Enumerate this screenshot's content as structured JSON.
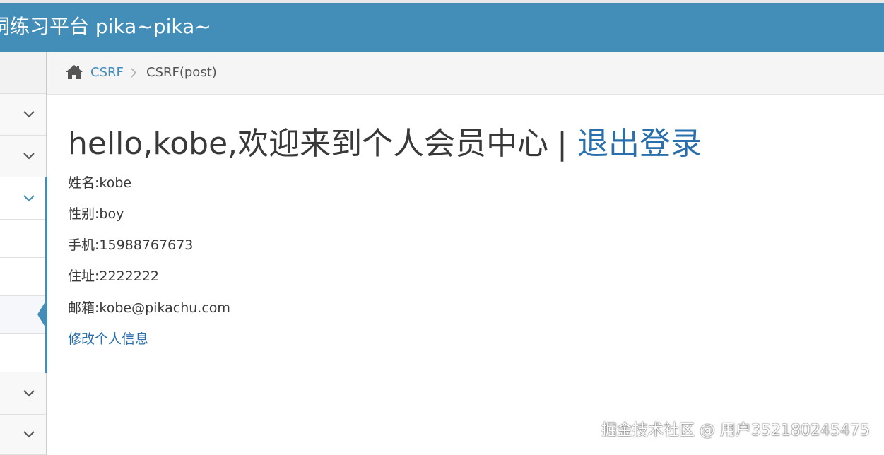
{
  "header": {
    "brand": "漏洞练习平台 pika~pika~",
    "brand_visible": "洞练习平台 pika~pika~"
  },
  "sidebar": {
    "rows": [
      {
        "has_chevron": true,
        "expanded": false
      },
      {
        "has_chevron": true,
        "expanded": false
      },
      {
        "has_chevron": true,
        "expanded": true
      },
      {
        "has_chevron": false
      },
      {
        "has_chevron": false
      },
      {
        "has_chevron": false,
        "active": true
      },
      {
        "has_chevron": false
      },
      {
        "has_chevron": true,
        "expanded": false
      },
      {
        "has_chevron": true,
        "expanded": false
      }
    ]
  },
  "breadcrumb": {
    "home_icon": "home-icon",
    "parent": "CSRF",
    "current": "CSRF(post)"
  },
  "main": {
    "heading_greeting": "hello,kobe,欢迎来到个人会员中心",
    "heading_separator": "|",
    "logout_label": "退出登录",
    "info": [
      "姓名:kobe",
      "性别:boy",
      "手机:15988767673",
      "住址:2222222",
      "邮箱:kobe@pikachu.com"
    ],
    "edit_link": "修改个人信息"
  },
  "watermark": "掘金技术社区 @ 用户352180245475",
  "colors": {
    "header_bg": "#438eb9",
    "link": "#2a6fad",
    "text": "#393939"
  }
}
